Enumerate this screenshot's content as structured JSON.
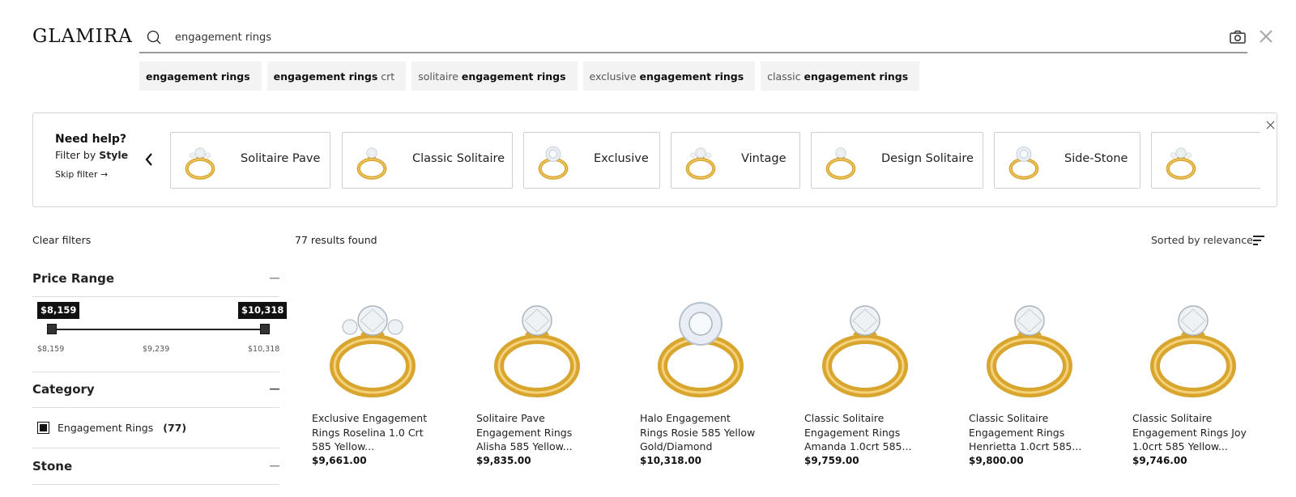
{
  "brand": {
    "logo": "GLAMIRA"
  },
  "search": {
    "query": "engagement rings"
  },
  "suggestions": [
    {
      "prefix": "",
      "bold": "engagement rings",
      "suffix": ""
    },
    {
      "prefix": "",
      "bold": "engagement rings",
      "suffix": " crt"
    },
    {
      "prefix": "solitaire ",
      "bold": "engagement rings",
      "suffix": ""
    },
    {
      "prefix": "exclusive ",
      "bold": "engagement rings",
      "suffix": ""
    },
    {
      "prefix": "classic ",
      "bold": "engagement rings",
      "suffix": ""
    }
  ],
  "style_filter": {
    "title": "Need help?",
    "sub_prefix": "Filter by ",
    "sub_bold": "Style",
    "skip": "Skip filter →",
    "styles": [
      {
        "label": "Solitaire Pave",
        "icon": "ring-icon"
      },
      {
        "label": "Classic Solitaire",
        "icon": "ring-icon"
      },
      {
        "label": "Exclusive",
        "icon": "ring-icon"
      },
      {
        "label": "Vintage",
        "icon": "ring-icon"
      },
      {
        "label": "Design Solitaire",
        "icon": "ring-icon"
      },
      {
        "label": "Side-Stone",
        "icon": "ring-icon"
      },
      {
        "label": "",
        "icon": "ring-icon"
      }
    ]
  },
  "filters": {
    "clear": "Clear filters",
    "price": {
      "title": "Price Range",
      "min_label": "$8,159",
      "max_label": "$10,318",
      "ticks": [
        "$8,159",
        "$9,239",
        "$10,318"
      ]
    },
    "category": {
      "title": "Category",
      "items": [
        {
          "label": "Engagement Rings",
          "count": "(77)",
          "checked": true
        }
      ]
    },
    "stone": {
      "title": "Stone"
    }
  },
  "results": {
    "count": "77 results found",
    "sort": "Sorted by relevance"
  },
  "products": [
    {
      "name": "Exclusive Engagement Rings Roselina 1.0 Crt 585 Yellow...",
      "price": "$9,661.00"
    },
    {
      "name": "Solitaire Pave Engagement Rings Alisha 585 Yellow...",
      "price": "$9,835.00"
    },
    {
      "name": "Halo Engagement Rings Rosie 585 Yellow Gold/Diamond",
      "price": "$10,318.00"
    },
    {
      "name": "Classic Solitaire Engagement Rings Amanda 1.0crt 585...",
      "price": "$9,759.00"
    },
    {
      "name": "Classic Solitaire Engagement Rings Henrietta 1.0crt 585...",
      "price": "$9,800.00"
    },
    {
      "name": "Classic Solitaire Engagement Rings Joy 1.0crt 585 Yellow...",
      "price": "$9,746.00"
    }
  ],
  "colors": {
    "gold": "#d8a52e",
    "accent": "#111111",
    "chip_bg": "#f3f3f3"
  }
}
